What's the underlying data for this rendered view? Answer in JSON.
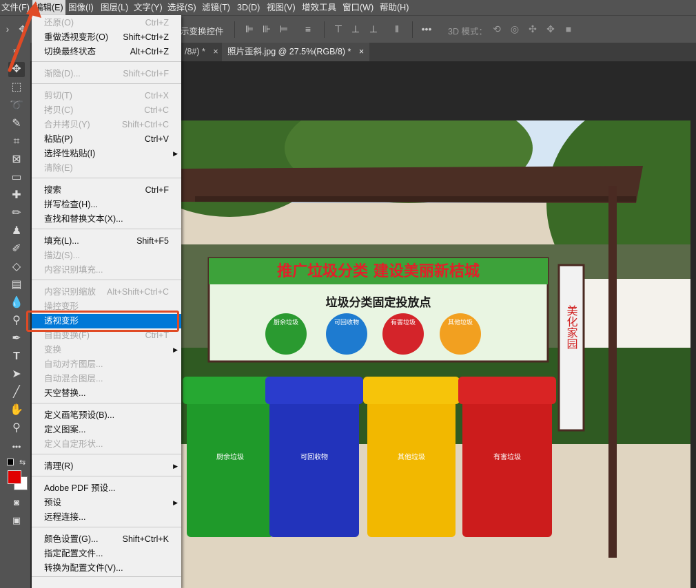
{
  "menubar": {
    "items": [
      {
        "label": "文件(F)",
        "open": false
      },
      {
        "label": "编辑(E)",
        "open": true
      },
      {
        "label": "图像(I)",
        "open": false
      },
      {
        "label": "图层(L)",
        "open": false
      },
      {
        "label": "文字(Y)",
        "open": false
      },
      {
        "label": "选择(S)",
        "open": false
      },
      {
        "label": "滤镜(T)",
        "open": false
      },
      {
        "label": "3D(D)",
        "open": false
      },
      {
        "label": "视图(V)",
        "open": false
      },
      {
        "label": "增效工具",
        "open": false
      },
      {
        "label": "窗口(W)",
        "open": false
      },
      {
        "label": "帮助(H)",
        "open": false
      }
    ]
  },
  "options_bar": {
    "transform_controls_label": "示变换控件",
    "mode_3d_label": "3D 模式："
  },
  "tabs": [
    {
      "label": "/8#) *",
      "close": "×"
    },
    {
      "label": "照片歪斜.jpg @ 27.5%(RGB/8) *",
      "close": "×"
    }
  ],
  "colors": {
    "foreground": "#e00000",
    "background": "#ffffff",
    "highlight": "#0078d7",
    "annotation": "#e04a25"
  },
  "edit_menu": {
    "items": [
      {
        "label": "还原(O)",
        "shortcut": "Ctrl+Z",
        "disabled": true
      },
      {
        "label": "重做透视变形(O)",
        "shortcut": "Shift+Ctrl+Z",
        "disabled": false
      },
      {
        "label": "切换最终状态",
        "shortcut": "Alt+Ctrl+Z",
        "disabled": false
      },
      {
        "label": "渐隐(D)...",
        "shortcut": "Shift+Ctrl+F",
        "disabled": true
      },
      {
        "label": "剪切(T)",
        "shortcut": "Ctrl+X",
        "disabled": true
      },
      {
        "label": "拷贝(C)",
        "shortcut": "Ctrl+C",
        "disabled": true
      },
      {
        "label": "合并拷贝(Y)",
        "shortcut": "Shift+Ctrl+C",
        "disabled": true
      },
      {
        "label": "粘贴(P)",
        "shortcut": "Ctrl+V",
        "disabled": false
      },
      {
        "label": "选择性粘贴(I)",
        "shortcut": "",
        "disabled": false,
        "submenu": true
      },
      {
        "label": "清除(E)",
        "shortcut": "",
        "disabled": true
      },
      {
        "label": "搜索",
        "shortcut": "Ctrl+F",
        "disabled": false
      },
      {
        "label": "拼写检查(H)...",
        "shortcut": "",
        "disabled": false
      },
      {
        "label": "查找和替换文本(X)...",
        "shortcut": "",
        "disabled": false
      },
      {
        "label": "填充(L)...",
        "shortcut": "Shift+F5",
        "disabled": false
      },
      {
        "label": "描边(S)...",
        "shortcut": "",
        "disabled": true
      },
      {
        "label": "内容识别填充...",
        "shortcut": "",
        "disabled": true
      },
      {
        "label": "内容识别缩放",
        "shortcut": "Alt+Shift+Ctrl+C",
        "disabled": true
      },
      {
        "label": "操控变形",
        "shortcut": "",
        "disabled": true
      },
      {
        "label": "透视变形",
        "shortcut": "",
        "disabled": false,
        "highlighted": true
      },
      {
        "label": "自由变换(F)",
        "shortcut": "Ctrl+T",
        "disabled": true
      },
      {
        "label": "变换",
        "shortcut": "",
        "disabled": true,
        "submenu": true
      },
      {
        "label": "自动对齐图层...",
        "shortcut": "",
        "disabled": true
      },
      {
        "label": "自动混合图层...",
        "shortcut": "",
        "disabled": true
      },
      {
        "label": "天空替换...",
        "shortcut": "",
        "disabled": false
      },
      {
        "label": "定义画笔预设(B)...",
        "shortcut": "",
        "disabled": false
      },
      {
        "label": "定义图案...",
        "shortcut": "",
        "disabled": false
      },
      {
        "label": "定义自定形状...",
        "shortcut": "",
        "disabled": true
      },
      {
        "label": "清理(R)",
        "shortcut": "",
        "disabled": false,
        "submenu": true
      },
      {
        "label": "Adobe PDF 预设...",
        "shortcut": "",
        "disabled": false
      },
      {
        "label": "预设",
        "shortcut": "",
        "disabled": false,
        "submenu": true
      },
      {
        "label": "远程连接...",
        "shortcut": "",
        "disabled": false
      },
      {
        "label": "颜色设置(G)...",
        "shortcut": "Shift+Ctrl+K",
        "disabled": false
      },
      {
        "label": "指定配置文件...",
        "shortcut": "",
        "disabled": false
      },
      {
        "label": "转换为配置文件(V)...",
        "shortcut": "",
        "disabled": false
      }
    ]
  },
  "photo": {
    "banner_title": "推广垃圾分类  建设美丽新桔城",
    "banner_subtitle": "垃圾分类固定投放点",
    "circle_labels": [
      "厨余垃圾",
      "可回收物",
      "有害垃圾",
      "其他垃圾"
    ],
    "side_sign": "美化家园",
    "bins": [
      {
        "label": "厨余垃圾",
        "color": "#1f9a2a",
        "lid": "#26a832"
      },
      {
        "label": "可回收物",
        "color": "#2233bb",
        "lid": "#2a3ccc"
      },
      {
        "label": "其他垃圾",
        "color": "#f2b800",
        "lid": "#f6c40a"
      },
      {
        "label": "有害垃圾",
        "color": "#cc1c1c",
        "lid": "#d92424"
      }
    ]
  }
}
